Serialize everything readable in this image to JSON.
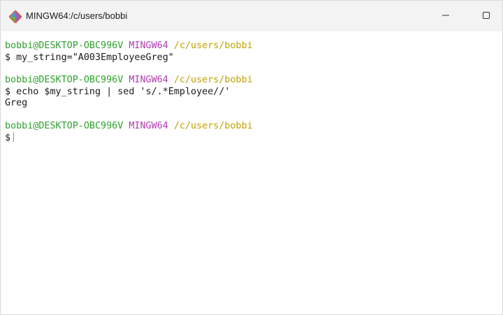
{
  "window": {
    "title": "MINGW64:/c/users/bobbi",
    "icon": "git-bash-icon",
    "controls": {
      "minimize": "minimize-icon",
      "maximize": "maximize-icon"
    }
  },
  "colors": {
    "user_host": "#2fa12f",
    "mingw": "#b23cb2",
    "path": "#c2a000",
    "text": "#1a1a1a"
  },
  "terminal": {
    "prompts": [
      {
        "user_host": "bobbi@DESKTOP-OBC996V",
        "shell": "MINGW64",
        "path": "/c/users/bobbi",
        "command": "$ my_string=\"A003EmployeeGreg\""
      },
      {
        "user_host": "bobbi@DESKTOP-OBC996V",
        "shell": "MINGW64",
        "path": "/c/users/bobbi",
        "command": "$ echo $my_string | sed 's/.*Employee//'",
        "output": "Greg"
      },
      {
        "user_host": "bobbi@DESKTOP-OBC996V",
        "shell": "MINGW64",
        "path": "/c/users/bobbi",
        "command": "$"
      }
    ]
  }
}
